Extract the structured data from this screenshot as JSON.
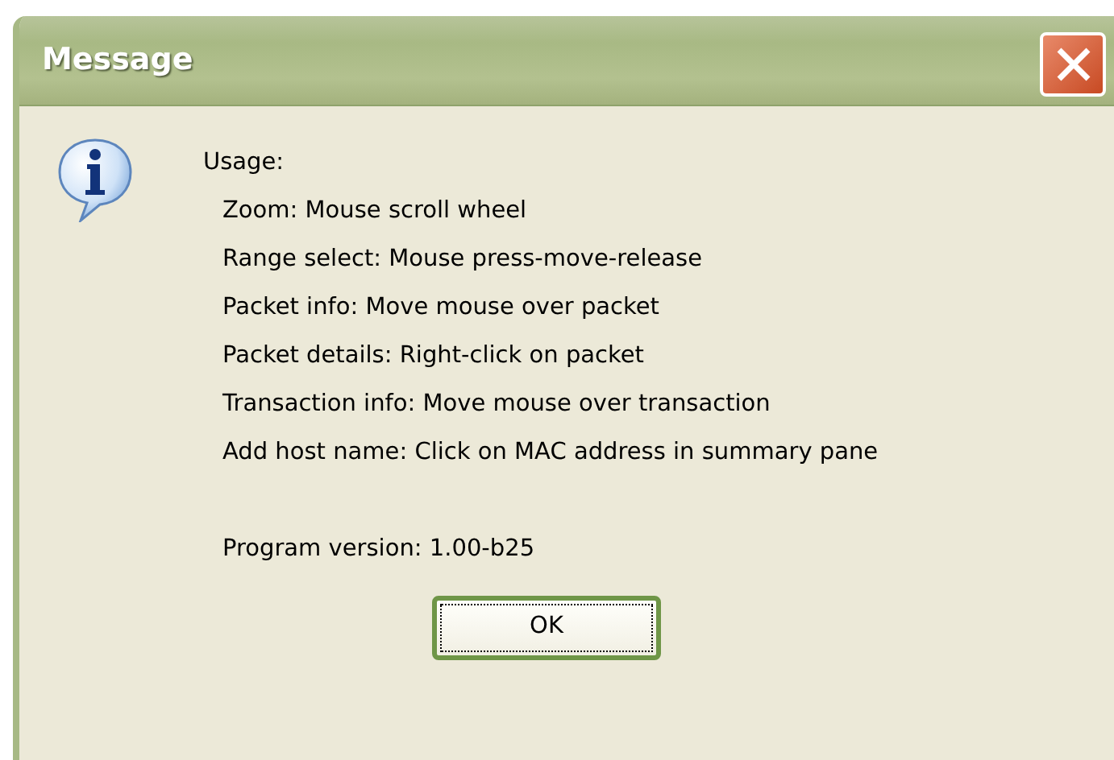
{
  "window": {
    "title": "Message"
  },
  "message": {
    "heading": "Usage:",
    "lines": [
      "Zoom: Mouse scroll wheel",
      "Range select: Mouse press-move-release",
      "Packet info: Move mouse over packet",
      "Packet details: Right-click on packet",
      "Transaction info: Move mouse over transaction",
      "Add host name: Click on MAC address in summary pane"
    ],
    "version": "Program version: 1.00-b25"
  },
  "buttons": [
    {
      "label": "OK",
      "focused": true
    }
  ]
}
